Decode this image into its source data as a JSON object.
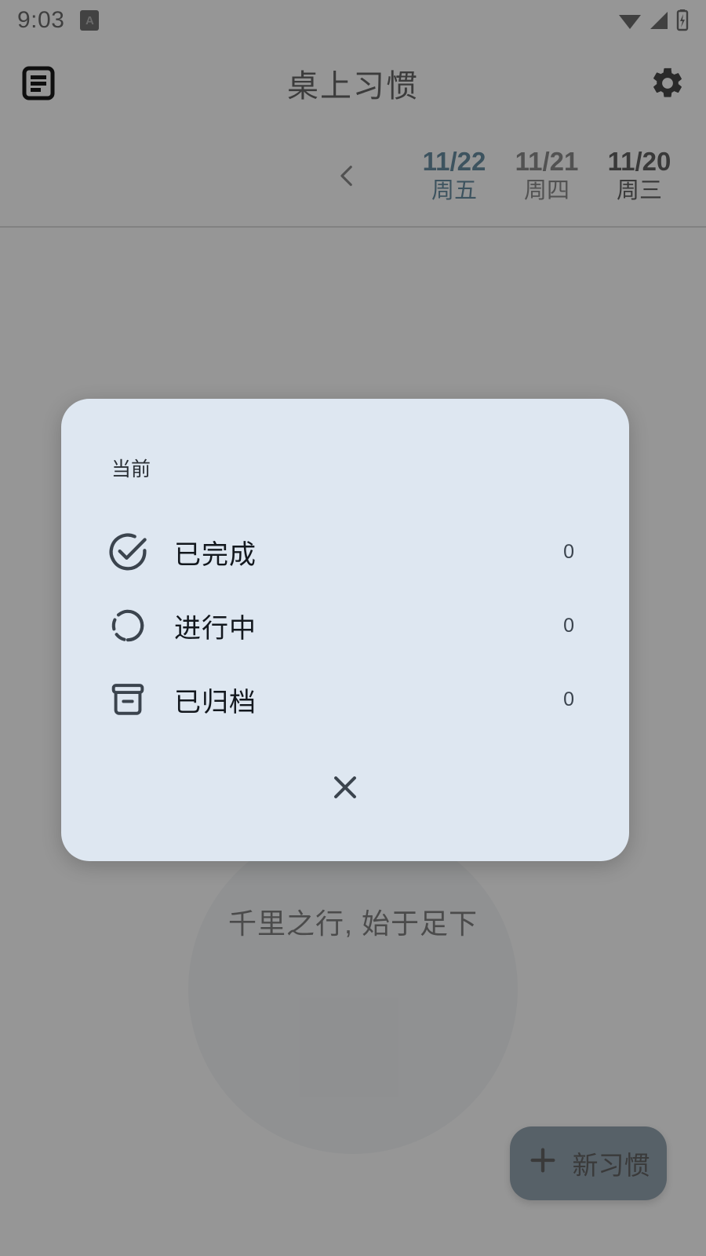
{
  "status_bar": {
    "clock": "9:03",
    "badge_letter": "A",
    "icons": [
      "wifi-icon",
      "cellular-signal-icon",
      "battery-charging-icon"
    ]
  },
  "app_bar": {
    "title": "桌上习惯",
    "left_icon": "notes-list-icon",
    "right_icon": "gear-icon"
  },
  "date_strip": {
    "prev_icon": "chevron-left-icon",
    "days": [
      {
        "date": "11/22",
        "weekday": "周五",
        "state": "selected"
      },
      {
        "date": "11/21",
        "weekday": "周四",
        "state": "dim"
      },
      {
        "date": "11/20",
        "weekday": "周三",
        "state": "today"
      }
    ]
  },
  "content": {
    "motto": "千里之行, 始于足下"
  },
  "fab": {
    "icon": "plus-icon",
    "label": "新习惯"
  },
  "dialog": {
    "section_label": "当前",
    "rows": [
      {
        "icon": "check-circle-icon",
        "label": "已完成",
        "count": "0"
      },
      {
        "icon": "dashed-circle-icon",
        "label": "进行中",
        "count": "0"
      },
      {
        "icon": "archive-box-icon",
        "label": "已归档",
        "count": "0"
      }
    ],
    "close_icon": "close-icon"
  },
  "colors": {
    "accent_selected_date": "#15506e",
    "dialog_background": "#dee7f1",
    "fab_background": "#5b7387",
    "scrim": "#757575",
    "icon_stroke": "#3b444e"
  }
}
